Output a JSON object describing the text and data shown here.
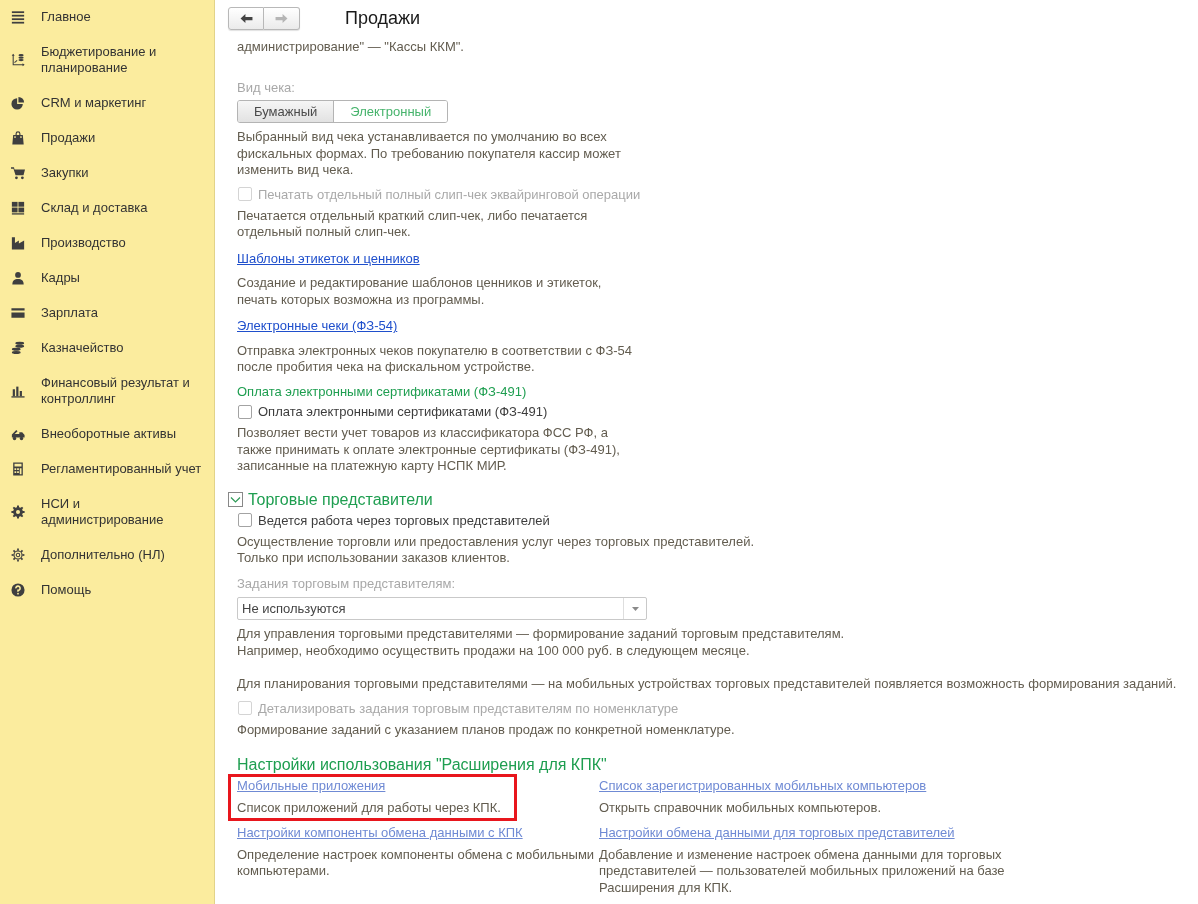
{
  "sidebar": {
    "items": [
      {
        "label": "Главное"
      },
      {
        "label": "Бюджетирование и\nпланирование"
      },
      {
        "label": "CRM и маркетинг"
      },
      {
        "label": "Продажи"
      },
      {
        "label": "Закупки"
      },
      {
        "label": "Склад и доставка"
      },
      {
        "label": "Производство"
      },
      {
        "label": "Кадры"
      },
      {
        "label": "Зарплата"
      },
      {
        "label": "Казначейство"
      },
      {
        "label": "Финансовый результат и\nконтроллинг"
      },
      {
        "label": "Внеоборотные активы"
      },
      {
        "label": "Регламентированный учет"
      },
      {
        "label": "НСИ и\nадминистрирование"
      },
      {
        "label": "Дополнительно (НЛ)"
      },
      {
        "label": "Помощь"
      }
    ]
  },
  "header": {
    "nav": [
      {
        "kind": "back",
        "disabled": false
      },
      {
        "kind": "forward",
        "disabled": true
      }
    ],
    "title": "Продажи"
  },
  "content": {
    "top_text": "администрирование\" — \"Кассы ККМ\".",
    "blocks": [
      {
        "kind": "label",
        "text": "Вид чека:"
      },
      {
        "kind": "toggle",
        "options": [
          {
            "label": "Бумажный",
            "selected": true
          },
          {
            "label": "Электронный",
            "selected": false
          }
        ]
      },
      {
        "kind": "text",
        "text": "Выбранный вид чека устанавливается по умолчанию во всех\nфискальных формах. По требованию покупателя кассир может\nизменить вид чека."
      },
      {
        "kind": "checkbox",
        "label": "Печатать отдельный полный слип-чек эквайринговой операции",
        "checked": false,
        "disabled": true
      },
      {
        "kind": "text",
        "text": "Печатается отдельный краткий слип-чек, либо печатается\nотдельный полный слип-чек."
      },
      {
        "kind": "link",
        "text": "Шаблоны этикеток и ценников"
      },
      {
        "kind": "text",
        "text": "Создание и редактирование шаблонов ценников и этикеток,\nпечать которых возможна из программы."
      },
      {
        "kind": "link",
        "text": "Электронные чеки (ФЗ-54)"
      },
      {
        "kind": "text",
        "text": "Отправка электронных чеков покупателю в соответствии с ФЗ-54\nпосле пробития чека на фискальном устройстве."
      },
      {
        "kind": "subheading",
        "text": "Оплата электронными сертификатами (ФЗ-491)"
      },
      {
        "kind": "checkbox",
        "label": "Оплата электронными сертификатами (ФЗ-491)",
        "checked": false,
        "disabled": false
      },
      {
        "kind": "text",
        "text": "Позволяет вести учет товаров из классификатора ФСС РФ, а\nтакже принимать к оплате электронные сертификаты (ФЗ-491),\nзаписанные на платежную карту НСПК МИР."
      },
      {
        "kind": "section",
        "title": "Торговые представители",
        "expanded": true,
        "focused": true,
        "children": [
          {
            "kind": "checkbox",
            "label": "Ведется работа через торговых представителей",
            "checked": false,
            "disabled": false
          },
          {
            "kind": "text",
            "text": "Осуществление торговли или предоставления услуг через торговых представителей.\nТолько при использовании заказов клиентов."
          },
          {
            "kind": "label",
            "text": "Задания торговым представителям:"
          },
          {
            "kind": "dropdown",
            "value": "Не используются"
          },
          {
            "kind": "text",
            "text": "Для управления торговыми представителями — формирование заданий торговым представителям.\nНапример, необходимо осуществить продажи на 100 000 руб. в следующем месяце."
          },
          {
            "kind": "text",
            "text": "Для планирования торговыми представителями — на мобильных устройствах торговых представителей появляется возможность формирования заданий."
          },
          {
            "kind": "checkbox",
            "label": "Детализировать задания торговым представителям по номенклатуре",
            "checked": false,
            "disabled": true
          },
          {
            "kind": "text",
            "text": "Формирование заданий с указанием планов продаж по конкретной номенклатуре."
          }
        ]
      },
      {
        "kind": "links",
        "title": "Настройки использования \"Расширения для КПК\"",
        "items": [
          {
            "link": "Мобильные приложения",
            "text": "Список приложений для работы через КПК.",
            "highlighted": true
          },
          {
            "link": "Список зарегистрированных мобильных компьютеров",
            "text": "Открыть справочник мобильных компьютеров.",
            "highlighted": false
          },
          {
            "link": "Настройки компоненты обмена данными с КПК",
            "text": "Определение настроек компоненты обмена с мобильными\nкомпьютерами.",
            "highlighted": false
          },
          {
            "link": "Настройки обмена данными для торговых представителей",
            "text": "Добавление и изменение настроек обмена данными для торговых\nпредставителей — пользователей мобильных приложений на базе\nРасширения для КПК.",
            "highlighted": false
          }
        ]
      }
    ]
  }
}
